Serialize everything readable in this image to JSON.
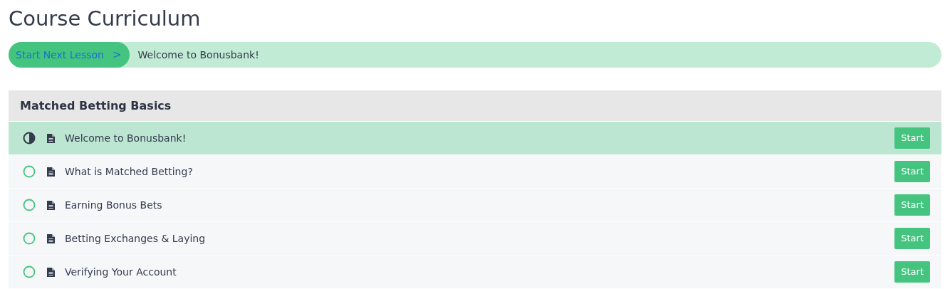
{
  "title": "Course Curriculum",
  "next_lesson": {
    "button": "Start Next Lesson",
    "caret": ">",
    "lesson": "Welcome to Bonusbank!"
  },
  "section": {
    "title": "Matched Betting Basics",
    "lessons": [
      {
        "title": "Welcome to Bonusbank!",
        "kind": "in_progress",
        "selected": true,
        "action": "Start"
      },
      {
        "title": "What is Matched Betting?",
        "kind": "not_started",
        "selected": false,
        "action": "Start"
      },
      {
        "title": "Earning Bonus Bets",
        "kind": "not_started",
        "selected": false,
        "action": "Start"
      },
      {
        "title": "Betting Exchanges & Laying",
        "kind": "not_started",
        "selected": false,
        "action": "Start"
      },
      {
        "title": "Verifying Your Account",
        "kind": "not_started",
        "selected": false,
        "action": "Start"
      }
    ]
  }
}
